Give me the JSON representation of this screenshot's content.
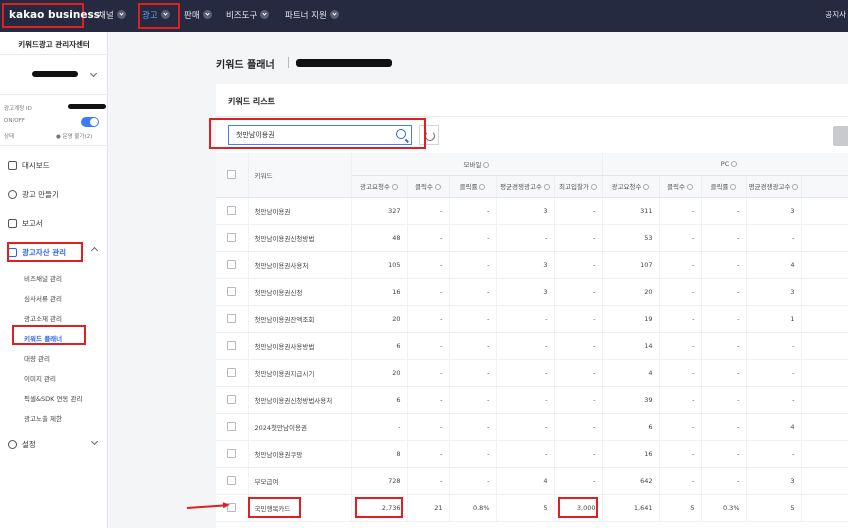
{
  "header": {
    "logo": "kakao business",
    "nav": [
      "채널",
      "광고",
      "판매",
      "비즈도구",
      "파트너 지원"
    ],
    "notice": "공지사"
  },
  "sidebar": {
    "title": "키워드광고 관리자센터",
    "account_id_label": "광고계정 ID",
    "onoff_label": "ON/OFF",
    "status_label": "상태",
    "status_value": "● 운영 불가(2)",
    "menu": [
      {
        "label": "대시보드",
        "icon": "dashboard-icon"
      },
      {
        "label": "광고 만들기",
        "icon": "plus-circle-icon"
      },
      {
        "label": "보고서",
        "icon": "report-icon"
      },
      {
        "label": "광고자산 관리",
        "icon": "layers-icon"
      }
    ],
    "submenu": [
      "비즈채널 관리",
      "심사서류 관리",
      "광고소재 관리",
      "키워드 플래너",
      "대량 관리",
      "이미지 관리",
      "픽셀&SDK 연동 관리",
      "광고노출 제한"
    ],
    "settings": "설정"
  },
  "main": {
    "page_title": "키워드 플래너",
    "card_title": "키워드 리스트",
    "search_value": "첫만남이용권"
  },
  "table": {
    "keyword_header": "키워드",
    "mobile_header": "모바일",
    "pc_header": "PC",
    "sub_headers": [
      "광고요청수",
      "클릭수",
      "클릭률",
      "평균경쟁광고수",
      "최고입찰가",
      "광고요청수",
      "클릭수",
      "클릭률",
      "평균경쟁광고수"
    ],
    "rows": [
      {
        "kw": "첫만남이용권",
        "v": [
          "327",
          "-",
          "-",
          "3",
          "-",
          "311",
          "-",
          "-",
          "3"
        ]
      },
      {
        "kw": "첫만남이용권신청방법",
        "v": [
          "48",
          "-",
          "-",
          "-",
          "-",
          "53",
          "-",
          "-",
          "-"
        ]
      },
      {
        "kw": "첫만남이용권사용처",
        "v": [
          "105",
          "-",
          "-",
          "3",
          "-",
          "107",
          "-",
          "-",
          "4"
        ]
      },
      {
        "kw": "첫만남이용권신청",
        "v": [
          "16",
          "-",
          "-",
          "3",
          "-",
          "20",
          "-",
          "-",
          "3"
        ]
      },
      {
        "kw": "첫만남이용권잔액조회",
        "v": [
          "20",
          "-",
          "-",
          "-",
          "-",
          "19",
          "-",
          "-",
          "1"
        ]
      },
      {
        "kw": "첫만남이용권사용방법",
        "v": [
          "6",
          "-",
          "-",
          "-",
          "-",
          "14",
          "-",
          "-",
          "-"
        ]
      },
      {
        "kw": "첫만남이용권지급시기",
        "v": [
          "20",
          "-",
          "-",
          "-",
          "-",
          "4",
          "-",
          "-",
          "-"
        ]
      },
      {
        "kw": "첫만남이용권신청방법사용처",
        "v": [
          "6",
          "-",
          "-",
          "-",
          "-",
          "39",
          "-",
          "-",
          "-"
        ]
      },
      {
        "kw": "2024첫만남이용권",
        "v": [
          "-",
          "-",
          "-",
          "-",
          "-",
          "6",
          "-",
          "-",
          "4"
        ]
      },
      {
        "kw": "첫만남이용권쿠팡",
        "v": [
          "8",
          "-",
          "-",
          "-",
          "-",
          "16",
          "-",
          "-",
          "-"
        ]
      },
      {
        "kw": "부모급여",
        "v": [
          "728",
          "-",
          "-",
          "4",
          "-",
          "642",
          "-",
          "-",
          "3"
        ]
      },
      {
        "kw": "국민행복카드",
        "v": [
          "2,736",
          "21",
          "0.8%",
          "5",
          "3,000",
          "1,641",
          "5",
          "0.3%",
          "5"
        ]
      }
    ]
  }
}
